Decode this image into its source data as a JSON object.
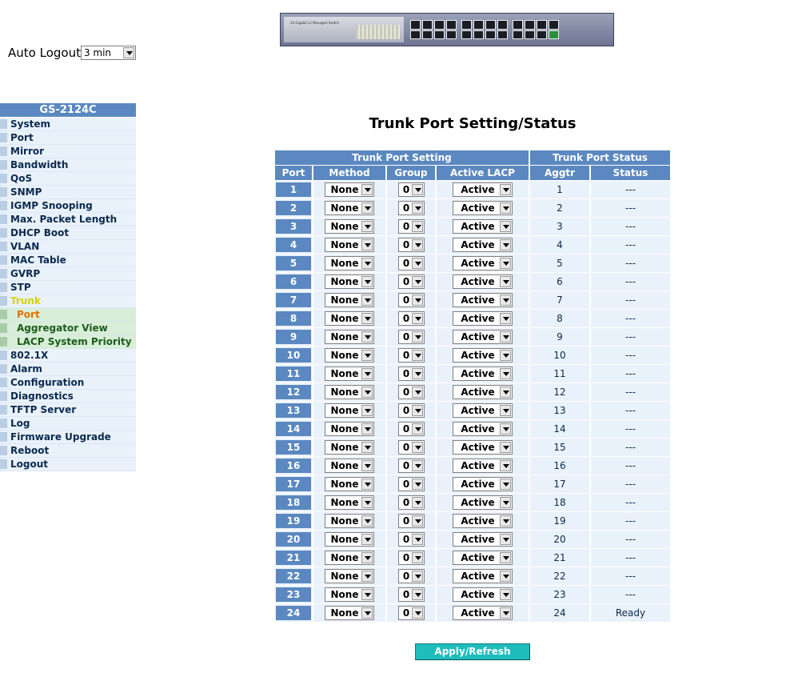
{
  "banner": {
    "model_text": "24 Gigabit L2 Managed Switch"
  },
  "auto_logout": {
    "label": "Auto Logout",
    "selected": "3 min"
  },
  "sidebar": {
    "title": "GS-2124C",
    "items": [
      "System",
      "Port",
      "Mirror",
      "Bandwidth",
      "QoS",
      "SNMP",
      "IGMP Snooping",
      "Max. Packet Length",
      "DHCP Boot",
      "VLAN",
      "MAC Table",
      "GVRP",
      "STP",
      "Trunk"
    ],
    "trunk_sub": [
      "Port",
      "Aggregator View",
      "LACP System Priority"
    ],
    "items_after": [
      "802.1X",
      "Alarm",
      "Configuration",
      "Diagnostics",
      "TFTP Server",
      "Log",
      "Firmware Upgrade",
      "Reboot",
      "Logout"
    ]
  },
  "main": {
    "title": "Trunk Port Setting/Status",
    "group_headers": {
      "setting": "Trunk Port Setting",
      "status": "Trunk Port Status"
    },
    "columns": [
      "Port",
      "Method",
      "Group",
      "Active LACP",
      "Aggtr",
      "Status"
    ],
    "rows": [
      {
        "port": "1",
        "method": "None",
        "group": "0",
        "lacp": "Active",
        "aggtr": "1",
        "status": "---"
      },
      {
        "port": "2",
        "method": "None",
        "group": "0",
        "lacp": "Active",
        "aggtr": "2",
        "status": "---"
      },
      {
        "port": "3",
        "method": "None",
        "group": "0",
        "lacp": "Active",
        "aggtr": "3",
        "status": "---"
      },
      {
        "port": "4",
        "method": "None",
        "group": "0",
        "lacp": "Active",
        "aggtr": "4",
        "status": "---"
      },
      {
        "port": "5",
        "method": "None",
        "group": "0",
        "lacp": "Active",
        "aggtr": "5",
        "status": "---"
      },
      {
        "port": "6",
        "method": "None",
        "group": "0",
        "lacp": "Active",
        "aggtr": "6",
        "status": "---"
      },
      {
        "port": "7",
        "method": "None",
        "group": "0",
        "lacp": "Active",
        "aggtr": "7",
        "status": "---"
      },
      {
        "port": "8",
        "method": "None",
        "group": "0",
        "lacp": "Active",
        "aggtr": "8",
        "status": "---"
      },
      {
        "port": "9",
        "method": "None",
        "group": "0",
        "lacp": "Active",
        "aggtr": "9",
        "status": "---"
      },
      {
        "port": "10",
        "method": "None",
        "group": "0",
        "lacp": "Active",
        "aggtr": "10",
        "status": "---"
      },
      {
        "port": "11",
        "method": "None",
        "group": "0",
        "lacp": "Active",
        "aggtr": "11",
        "status": "---"
      },
      {
        "port": "12",
        "method": "None",
        "group": "0",
        "lacp": "Active",
        "aggtr": "12",
        "status": "---"
      },
      {
        "port": "13",
        "method": "None",
        "group": "0",
        "lacp": "Active",
        "aggtr": "13",
        "status": "---"
      },
      {
        "port": "14",
        "method": "None",
        "group": "0",
        "lacp": "Active",
        "aggtr": "14",
        "status": "---"
      },
      {
        "port": "15",
        "method": "None",
        "group": "0",
        "lacp": "Active",
        "aggtr": "15",
        "status": "---"
      },
      {
        "port": "16",
        "method": "None",
        "group": "0",
        "lacp": "Active",
        "aggtr": "16",
        "status": "---"
      },
      {
        "port": "17",
        "method": "None",
        "group": "0",
        "lacp": "Active",
        "aggtr": "17",
        "status": "---"
      },
      {
        "port": "18",
        "method": "None",
        "group": "0",
        "lacp": "Active",
        "aggtr": "18",
        "status": "---"
      },
      {
        "port": "19",
        "method": "None",
        "group": "0",
        "lacp": "Active",
        "aggtr": "19",
        "status": "---"
      },
      {
        "port": "20",
        "method": "None",
        "group": "0",
        "lacp": "Active",
        "aggtr": "20",
        "status": "---"
      },
      {
        "port": "21",
        "method": "None",
        "group": "0",
        "lacp": "Active",
        "aggtr": "21",
        "status": "---"
      },
      {
        "port": "22",
        "method": "None",
        "group": "0",
        "lacp": "Active",
        "aggtr": "22",
        "status": "---"
      },
      {
        "port": "23",
        "method": "None",
        "group": "0",
        "lacp": "Active",
        "aggtr": "23",
        "status": "---"
      },
      {
        "port": "24",
        "method": "None",
        "group": "0",
        "lacp": "Active",
        "aggtr": "24",
        "status": "Ready"
      }
    ],
    "apply_label": "Apply/Refresh"
  },
  "colors": {
    "header_blue": "#5b88c0",
    "cell_bg": "#e9f1fb",
    "apply_teal": "#1fbcbc",
    "trunk_active": "#d4d400",
    "sub_current": "#e07000"
  },
  "icons": {
    "dropdown": "chevron-down-icon",
    "device": "switch-front-panel-image"
  }
}
